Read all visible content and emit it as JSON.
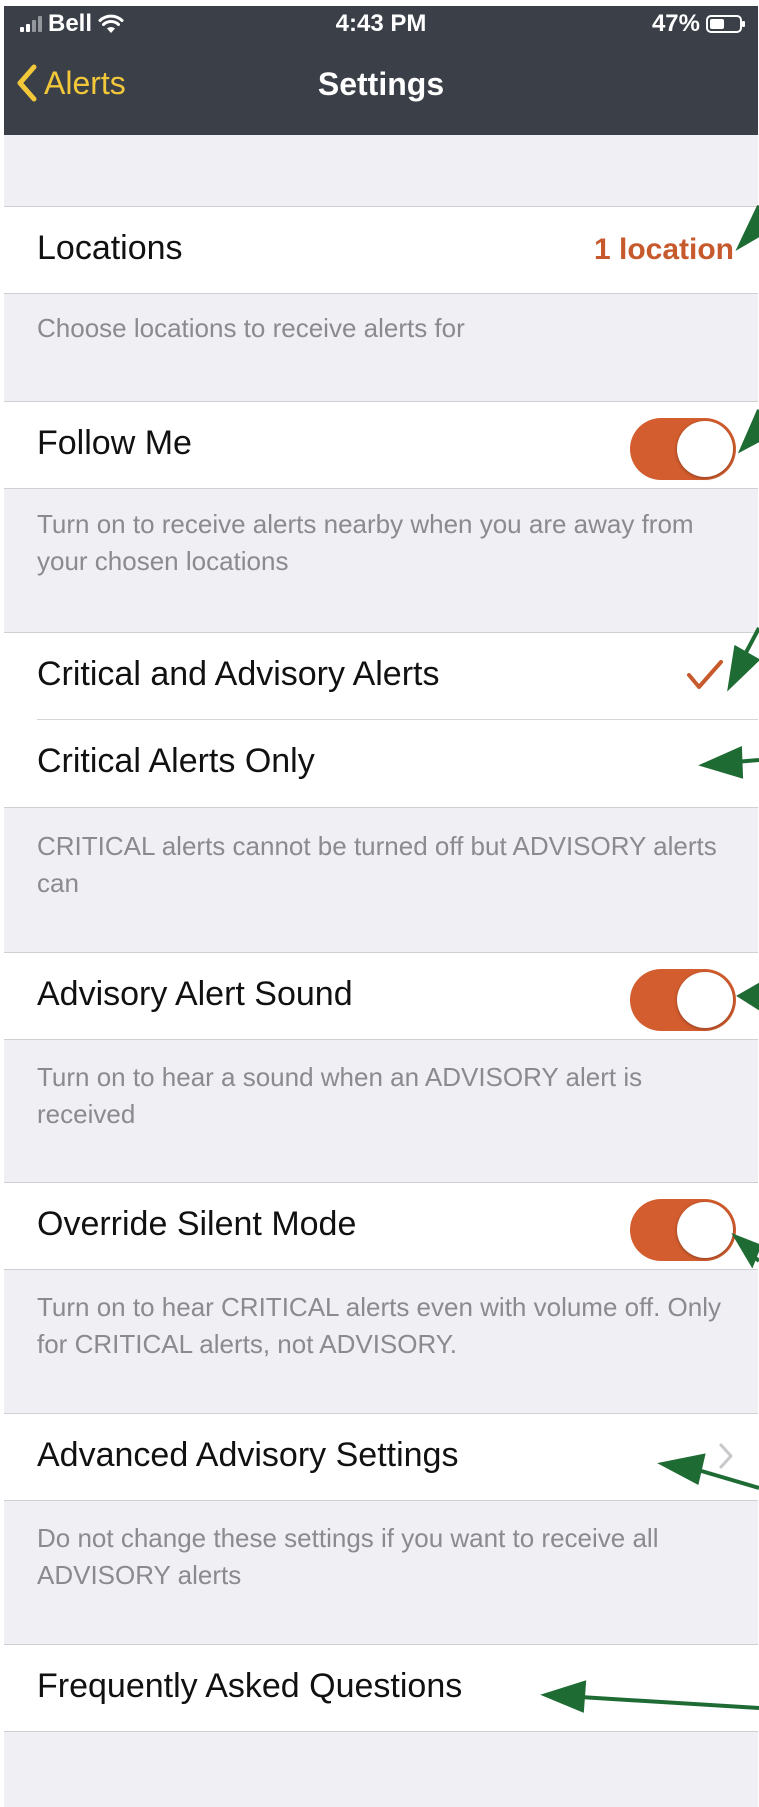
{
  "status_bar": {
    "carrier": "Bell",
    "time": "4:43 PM",
    "battery": "47%"
  },
  "nav": {
    "back_label": "Alerts",
    "title": "Settings"
  },
  "colors": {
    "accent": "#c75a2c",
    "nav_bg": "#3b4048",
    "back": "#f2c73a",
    "arrow": "#1f6b34"
  },
  "locations": {
    "label": "Locations",
    "value": "1 location",
    "footer": "Choose locations to receive alerts for"
  },
  "follow_me": {
    "label": "Follow Me",
    "on": true,
    "footer": "Turn on to receive alerts nearby when you are away from your chosen locations"
  },
  "alert_type": {
    "option_all": "Critical and Advisory Alerts",
    "option_critical": "Critical Alerts Only",
    "selected": "Critical and Advisory Alerts",
    "footer": "CRITICAL alerts cannot be turned off but ADVISORY alerts can"
  },
  "advisory_sound": {
    "label": "Advisory Alert Sound",
    "on": true,
    "footer": "Turn on to hear a sound when an ADVISORY alert is received"
  },
  "override_silent": {
    "label": "Override Silent Mode",
    "on": true,
    "footer": "Turn on to hear CRITICAL alerts even with volume off. Only for CRITICAL alerts, not ADVISORY."
  },
  "advanced": {
    "label": "Advanced Advisory Settings",
    "footer": "Do not change these settings if you want to receive all ADVISORY alerts"
  },
  "faq": {
    "label": "Frequently Asked Questions"
  }
}
